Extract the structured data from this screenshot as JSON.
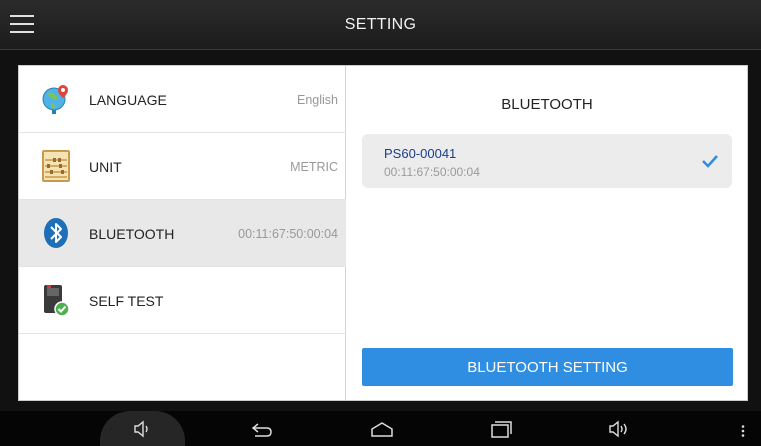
{
  "header": {
    "title": "SETTING"
  },
  "settings_list": [
    {
      "label": "LANGUAGE",
      "value": "English"
    },
    {
      "label": "UNIT",
      "value": "METRIC"
    },
    {
      "label": "BLUETOOTH",
      "value": "00:11:67:50:00:04"
    },
    {
      "label": "SELF TEST",
      "value": ""
    }
  ],
  "selected_item": "BLUETOOTH",
  "bluetooth_panel": {
    "title": "BLUETOOTH",
    "device": {
      "name": "PS60-00041",
      "address": "00:11:67:50:00:04",
      "connected": true
    },
    "button_label": "BLUETOOTH SETTING"
  },
  "colors": {
    "accent": "#2f8ee2",
    "selected_row": "#e8e8e8",
    "header_bg": "#222222"
  },
  "icons": {
    "menu": "hamburger-icon",
    "language": "globe-icon",
    "unit": "abacus-icon",
    "bluetooth": "bluetooth-icon",
    "self_test": "device-check-icon",
    "check": "checkmark-icon",
    "nav": [
      "volume-down-icon",
      "back-icon",
      "home-icon",
      "recents-icon",
      "volume-up-icon",
      "overflow-menu-icon"
    ]
  }
}
